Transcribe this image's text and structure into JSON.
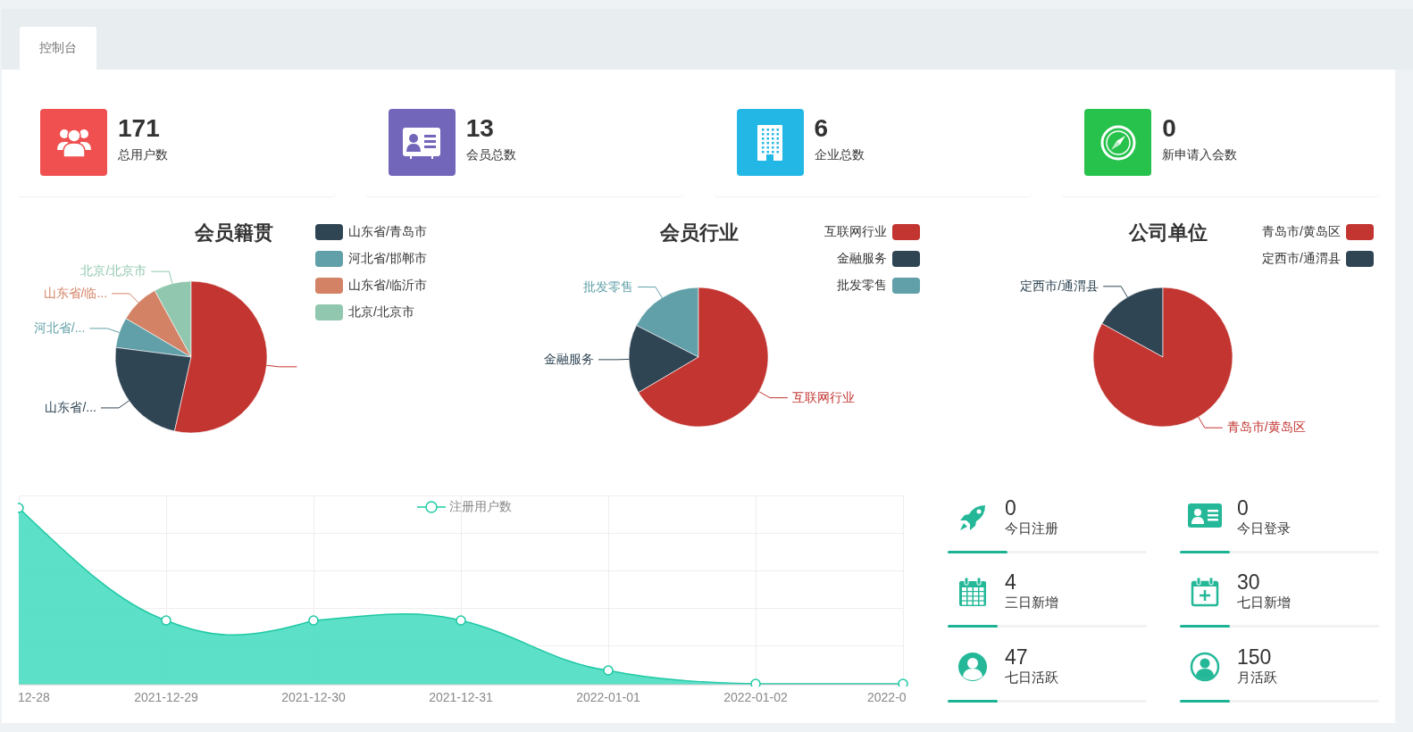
{
  "tabs": [
    {
      "label": "控制台",
      "selected": true
    }
  ],
  "summary_cards": [
    {
      "color": "#f05050",
      "value": "171",
      "label": "总用户数"
    },
    {
      "color": "#7266ba",
      "value": "13",
      "label": "会员总数"
    },
    {
      "color": "#23b7e5",
      "value": "6",
      "label": "企业总数"
    },
    {
      "color": "#27c24c",
      "value": "0",
      "label": "新申请入会数"
    }
  ],
  "pie_charts": [
    {
      "title": "会员籍贯",
      "legend": [
        {
          "label": "山东省/青岛市",
          "color": "#2f4554"
        },
        {
          "label": "河北省/邯郸市",
          "color": "#61a0a8"
        },
        {
          "label": "山东省/临沂市",
          "color": "#d48265"
        },
        {
          "label": "北京/北京市",
          "color": "#91c7ae"
        }
      ],
      "slices": [
        {
          "label": "北京/北京市",
          "color": "#91c7ae"
        },
        {
          "label": "山东省/临...",
          "color": "#d48265"
        },
        {
          "label": "河北省/...",
          "color": "#61a0a8"
        },
        {
          "label": "山东省/...",
          "color": "#2f4554"
        },
        {
          "color": "#c23531"
        }
      ]
    },
    {
      "title": "会员行业",
      "legend": [
        {
          "label": "互联网行业",
          "color": "#c23531"
        },
        {
          "label": "金融服务",
          "color": "#2f4554"
        },
        {
          "label": "批发零售",
          "color": "#61a0a8"
        }
      ],
      "slices": [
        {
          "label": "批发零售",
          "color": "#61a0a8"
        },
        {
          "label": "金融服务",
          "color": "#2f4554"
        },
        {
          "label": "互联网行业",
          "color": "#c23531"
        }
      ]
    },
    {
      "title": "公司单位",
      "legend": [
        {
          "label": "青岛市/黄岛区",
          "color": "#c23531"
        },
        {
          "label": "定西市/通渭县",
          "color": "#2f4554"
        }
      ],
      "slices": [
        {
          "label": "定西市/通渭县",
          "color": "#2f4554"
        },
        {
          "label": "青岛市/黄岛区",
          "color": "#c23531"
        }
      ]
    }
  ],
  "registration_chart": {
    "legend": "注册用户数",
    "x_labels": [
      "12-28",
      "2021-12-29",
      "2021-12-30",
      "2021-12-31",
      "2022-01-01",
      "2022-01-02",
      "2022-0"
    ]
  },
  "stats": [
    {
      "value": "0",
      "label": "今日注册",
      "level": 0.3
    },
    {
      "value": "0",
      "label": "今日登录",
      "level": 0.25
    },
    {
      "value": "4",
      "label": "三日新增",
      "level": 0.25
    },
    {
      "value": "30",
      "label": "七日新增",
      "level": 0.25
    },
    {
      "value": "47",
      "label": "七日活跃",
      "level": 0.25
    },
    {
      "value": "150",
      "label": "月活跃",
      "level": 0.25
    }
  ]
}
